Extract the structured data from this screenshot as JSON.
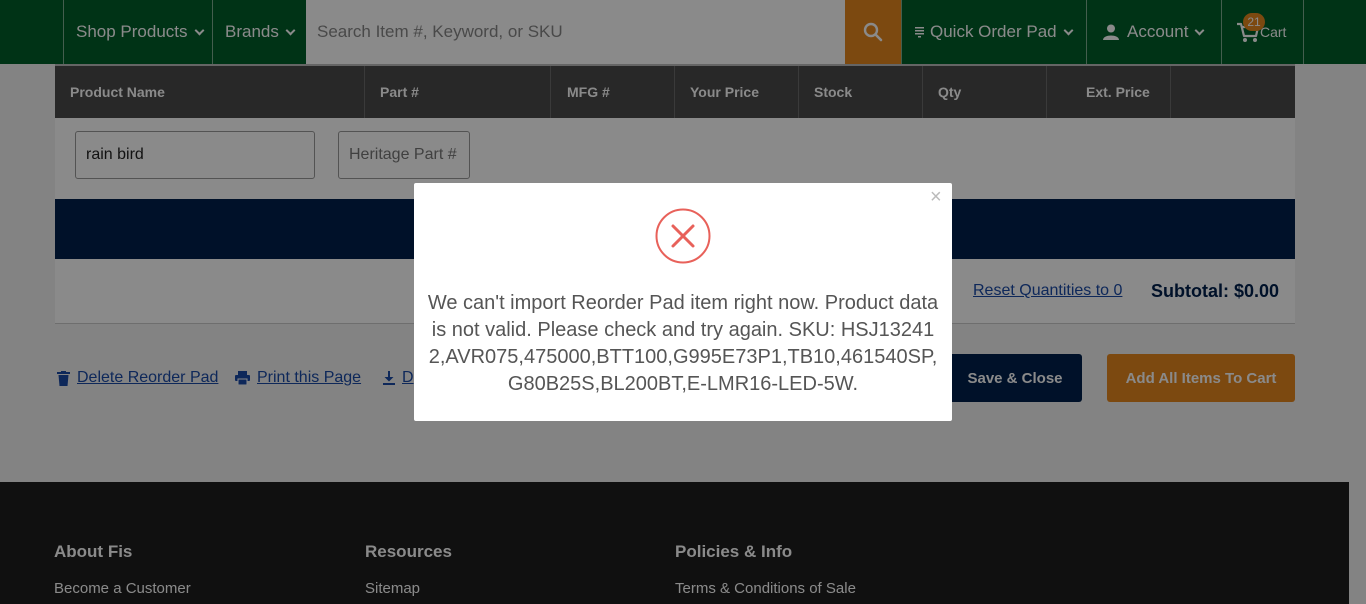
{
  "nav": {
    "shop_products": "Shop Products",
    "brands": "Brands",
    "search_placeholder": "Search Item #, Keyword, or SKU",
    "quick_order_pad": "Quick Order Pad",
    "account": "Account",
    "cart_label": "Cart",
    "cart_count": "21"
  },
  "table": {
    "columns": [
      "Product Name",
      "Part #",
      "MFG #",
      "Your Price",
      "Stock",
      "Qty",
      "Ext. Price"
    ],
    "product_name_value": "rain bird",
    "part_placeholder": "Heritage Part #"
  },
  "summary": {
    "reset_link": "Reset Quantities to 0",
    "subtotal": "Subtotal: $0.00"
  },
  "actions": {
    "delete": "Delete Reorder Pad",
    "print": "Print this Page",
    "download": "D",
    "save_close": "Save & Close",
    "add_all": "Add All Items To Cart"
  },
  "footer": {
    "col1_heading": "About Fis",
    "col1_link": "Become a Customer",
    "col2_heading": "Resources",
    "col2_link": "Sitemap",
    "col3_heading": "Policies & Info",
    "col3_link": "Terms & Conditions of Sale"
  },
  "modal": {
    "close": "×",
    "message": "We can't import Reorder Pad item right now. Product data is not valid. Please check and try again. SKU: HSJ132412,AVR075,475000,BTT100,G995E73P1,TB10,461540SP,G80B25S,BL200BT,E-LMR16-LED-5W."
  },
  "colors": {
    "nav_green": "#005e2a",
    "accent_orange": "#e6871e",
    "navy": "#00214d",
    "error_red": "#e8615a"
  },
  "icons": [
    "search-icon",
    "chevron-down-icon",
    "list-icon",
    "user-icon",
    "cart-icon",
    "trash-icon",
    "print-icon",
    "download-icon",
    "close-icon",
    "error-x-icon"
  ]
}
